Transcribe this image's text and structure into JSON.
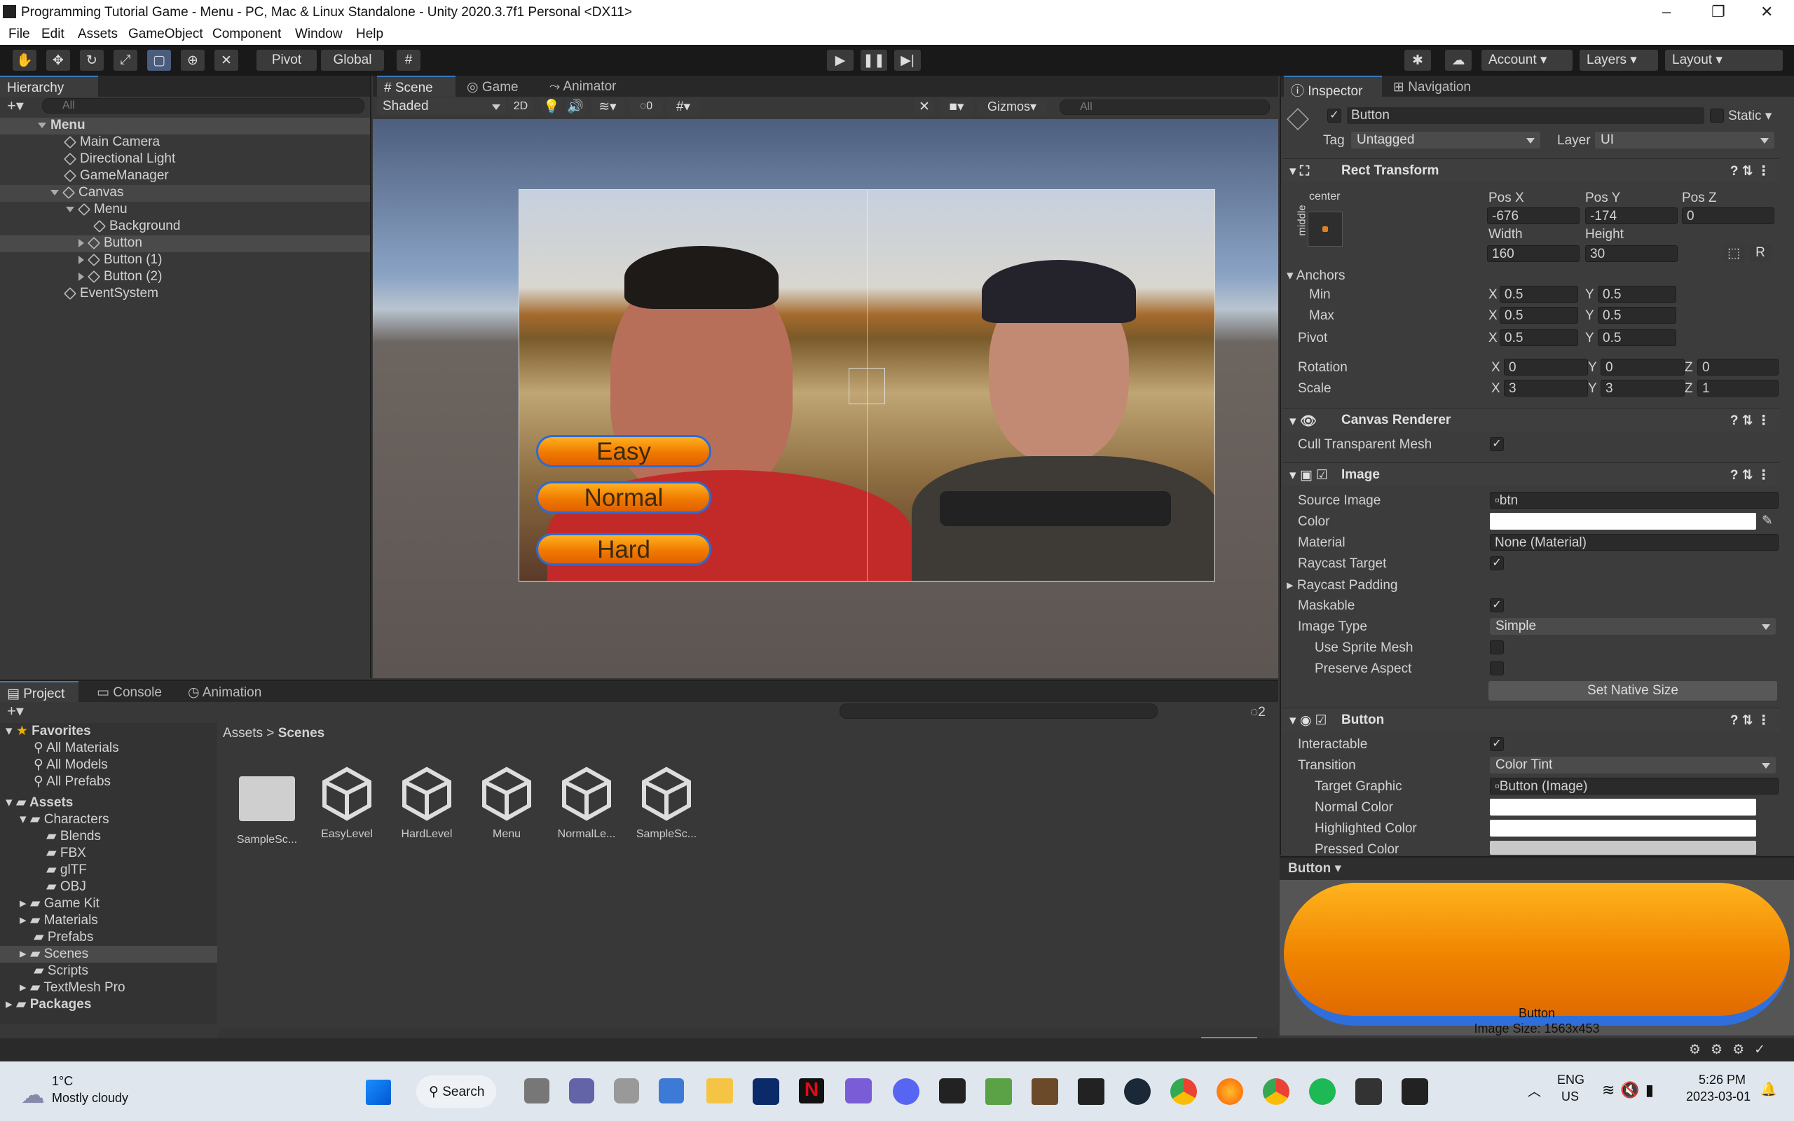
{
  "window": {
    "title": "Programming Tutorial Game - Menu - PC, Mac & Linux Standalone - Unity 2020.3.7f1 Personal <DX11>"
  },
  "menu": [
    "File",
    "Edit",
    "Assets",
    "GameObject",
    "Component",
    "Window",
    "Help"
  ],
  "toolbar": {
    "pivot": "Pivot",
    "global": "Global",
    "account": "Account",
    "layers": "Layers",
    "layout": "Layout"
  },
  "hierarchy": {
    "tab": "Hierarchy",
    "search": "All",
    "items": [
      "Menu",
      "Main Camera",
      "Directional Light",
      "GameManager",
      "Canvas",
      "Menu",
      "Background",
      "Button",
      "Button (1)",
      "Button (2)",
      "EventSystem"
    ]
  },
  "scene": {
    "tabs": [
      "Scene",
      "Game",
      "Animator"
    ],
    "shading": "Shaded",
    "mode2d": "2D",
    "hidden_count": "0",
    "gizmos": "Gizmos",
    "search": "All",
    "buttons": [
      "Easy",
      "Normal",
      "Hard"
    ]
  },
  "inspector": {
    "tabs": [
      "Inspector",
      "Navigation"
    ],
    "name": "Button",
    "static": "Static",
    "tag_label": "Tag",
    "tag": "Untagged",
    "layer_label": "Layer",
    "layer": "UI",
    "rect": {
      "title": "Rect Transform",
      "anchor_h": "center",
      "anchor_v": "middle",
      "posx_l": "Pos X",
      "posy_l": "Pos Y",
      "posz_l": "Pos Z",
      "posx": "-676",
      "posy": "-174",
      "posz": "0",
      "width_l": "Width",
      "height_l": "Height",
      "width": "160",
      "height": "30",
      "anchors": "Anchors",
      "min": "Min",
      "max": "Max",
      "pivot": "Pivot",
      "rotation": "Rotation",
      "scale": "Scale",
      "min_x": "0.5",
      "min_y": "0.5",
      "max_x": "0.5",
      "max_y": "0.5",
      "pivot_x": "0.5",
      "pivot_y": "0.5",
      "rot_x": "0",
      "rot_y": "0",
      "rot_z": "0",
      "scale_x": "3",
      "scale_y": "3",
      "scale_z": "1",
      "xl": "X",
      "yl": "Y",
      "zl": "Z"
    },
    "canvas_renderer": {
      "title": "Canvas Renderer",
      "cull": "Cull Transparent Mesh"
    },
    "image": {
      "title": "Image",
      "source_l": "Source Image",
      "source": "btn",
      "color_l": "Color",
      "material_l": "Material",
      "material": "None (Material)",
      "raycast_target": "Raycast Target",
      "raycast_padding": "Raycast Padding",
      "maskable": "Maskable",
      "image_type_l": "Image Type",
      "image_type": "Simple",
      "use_sprite_mesh": "Use Sprite Mesh",
      "preserve": "Preserve Aspect",
      "native": "Set Native Size"
    },
    "button": {
      "title": "Button",
      "interactable": "Interactable",
      "transition_l": "Transition",
      "transition": "Color Tint",
      "target_l": "Target Graphic",
      "target": "Button (Image)",
      "normal": "Normal Color",
      "highlighted": "Highlighted Color",
      "pressed": "Pressed Color"
    },
    "preview": {
      "title": "Button",
      "name": "Button",
      "size": "Image Size: 1563x453"
    }
  },
  "project": {
    "tabs": [
      "Project",
      "Console",
      "Animation"
    ],
    "badge": "2",
    "favorites": "Favorites",
    "fav_items": [
      "All Materials",
      "All Models",
      "All Prefabs"
    ],
    "assets": "Assets",
    "tree": [
      "Characters",
      "Blends",
      "FBX",
      "glTF",
      "OBJ",
      "Game Kit",
      "Materials",
      "Prefabs",
      "Scenes",
      "Scripts",
      "TextMesh Pro"
    ],
    "packages": "Packages",
    "breadcrumb": [
      "Assets",
      "Scenes"
    ],
    "files": [
      "SampleSc...",
      "EasyLevel",
      "HardLevel",
      "Menu",
      "NormalLe...",
      "SampleSc..."
    ]
  },
  "taskbar": {
    "temp": "1°C",
    "weather": "Mostly cloudy",
    "search": "Search",
    "lang1": "ENG",
    "lang2": "US",
    "time": "5:26 PM",
    "date": "2023-03-01"
  }
}
